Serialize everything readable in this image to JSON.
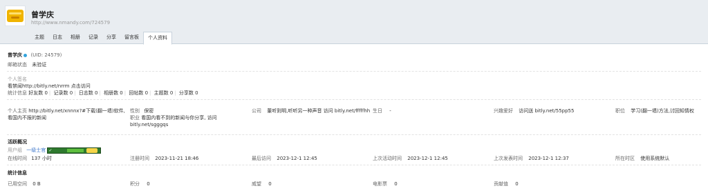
{
  "header": {
    "name": "曾学庆",
    "url": "http://www.nmandy.com/724579"
  },
  "tabs": [
    "主题",
    "日志",
    "相册",
    "记录",
    "分享",
    "留言板",
    "个人资料"
  ],
  "profile": {
    "name": "曾学庆",
    "uid": "(UID: 24579)",
    "email_label": "邮箱状态",
    "email_value": "未验证",
    "signature_label": "个人签名",
    "signature_text": "看禁闻http://bitly.net/nrrm 点击访问",
    "stats_label": "统计信息",
    "stats": [
      "好友数 0",
      "记录数 0",
      "日志数 0",
      "相册数 0",
      "回帖数 0",
      "主题数 0",
      "分享数 0"
    ]
  },
  "info": {
    "homepage_label": "个人主页",
    "homepage_value": "http://bitly.net/xnnnx?#下载(翻一墙)软件, 看国内不报的新闻",
    "gender_label": "性别",
    "gender_value": "保密",
    "job_label": "职业",
    "job_value": "看国内看不到的新闻与你分享, 访问 bitly.net/sgggqs",
    "company_label": "公司",
    "company_value": "董听则明,听听另一种声音 访问 bitly.net/fffffhh",
    "birthday_label": "生日",
    "birthday_value": "-",
    "hobby_label": "兴趣爱好",
    "hobby_value": "访问送 bitly.net/55pp55",
    "position_label": "职位",
    "position_value": "学习(翻一墙)方法,讨回知情权"
  },
  "activity": {
    "title": "活跃概况",
    "group_label": "用户组",
    "group_value": "一级士官",
    "online_label": "在线时间",
    "online_value": "137 小时",
    "reg_label": "注册时间",
    "reg_value": "2023-11-21 18:46",
    "last_visit_label": "最后访问",
    "last_visit_value": "2023-12-1 12:45",
    "last_active_label": "上次活动时间",
    "last_active_value": "2023-12-1 12:45",
    "last_post_label": "上次发表时间",
    "last_post_value": "2023-12-1 12:37",
    "tz_label": "所在时区",
    "tz_value": "使用系统默认"
  },
  "statistics": {
    "title": "统计信息",
    "space_label": "已用空间",
    "space_value": "0 B",
    "points_label": "积分",
    "points_value": "0",
    "prestige_label": "威望",
    "prestige_value": "0",
    "movie_label": "电影票",
    "movie_value": "0",
    "contrib_label": "贡献值",
    "contrib_value": "0"
  }
}
